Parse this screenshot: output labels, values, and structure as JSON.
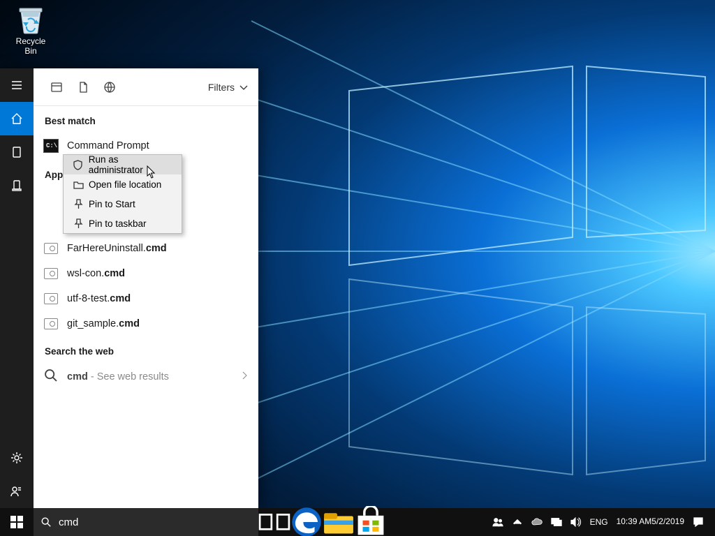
{
  "desktop": {
    "recycle_bin": "Recycle Bin"
  },
  "search": {
    "scope": {
      "filters_label": "Filters"
    },
    "best_match_header": "Best match",
    "best_match_item": "Command Prompt",
    "apps_header": "Apps",
    "apps_trunc": "App",
    "app_results": [
      {
        "pre": "FarHereUninstall.",
        "bold": "cmd"
      },
      {
        "pre": "wsl-con.",
        "bold": "cmd"
      },
      {
        "pre": "utf-8-test.",
        "bold": "cmd"
      },
      {
        "pre": "git_sample.",
        "bold": "cmd"
      }
    ],
    "web_header": "Search the web",
    "web_query": "cmd",
    "web_hint": " - See web results",
    "input_value": "cmd"
  },
  "context_menu": {
    "items": [
      "Run as administrator",
      "Open file location",
      "Pin to Start",
      "Pin to taskbar"
    ]
  },
  "tray": {
    "lang": "ENG",
    "time": "10:39 AM",
    "date": "5/2/2019"
  }
}
